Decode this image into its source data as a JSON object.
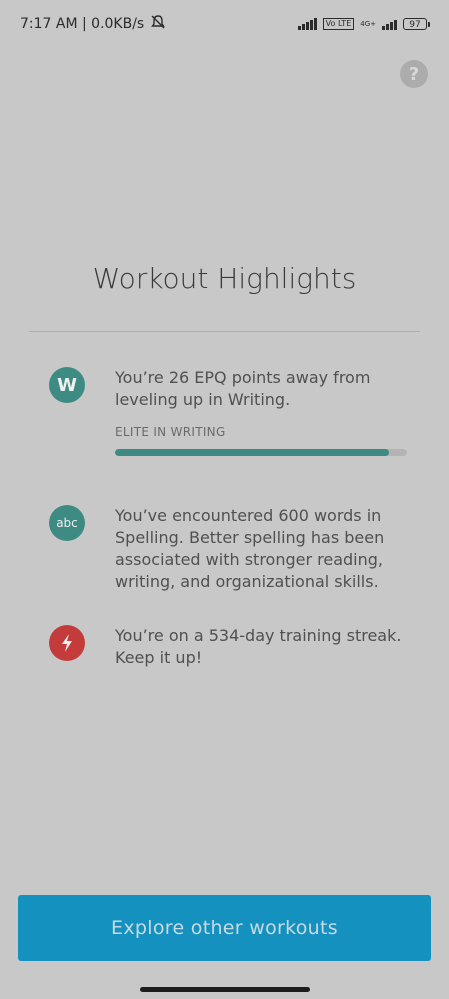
{
  "status_bar": {
    "time_text": "7:17 AM | 0.0KB/s",
    "sim_label": "Vo LTE",
    "network_label": "4G+",
    "battery": "97"
  },
  "title": "Workout Highlights",
  "highlights": [
    {
      "icon": "W",
      "icon_color": "#3e8b84",
      "text": "You’re 26 EPQ points away from leveling up in Writing.",
      "progress_label": "ELITE IN WRITING",
      "progress": 0.94
    },
    {
      "icon": "abc",
      "icon_color": "#3e8b84",
      "text": "You’ve encountered 600 words in Spelling. Better spelling has been associated with stronger reading, writing, and organizational skills."
    },
    {
      "icon": "lightning-icon",
      "icon_color": "#c43b3b",
      "text": "You’re on a 534-day training streak. Keep it up!"
    }
  ],
  "cta": {
    "label": "Explore other workouts",
    "color": "#1591bf"
  }
}
